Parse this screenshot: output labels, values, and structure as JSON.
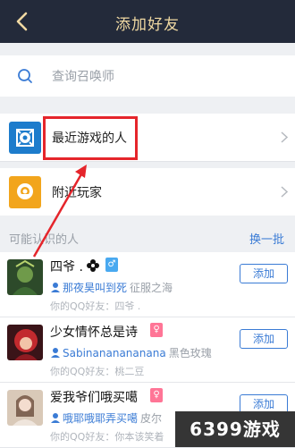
{
  "header": {
    "title": "添加好友"
  },
  "search": {
    "placeholder": "查询召唤师"
  },
  "menu": [
    {
      "label": "最近游戏的人",
      "icon": "recent-players-icon"
    },
    {
      "label": "附近玩家",
      "icon": "nearby-players-icon"
    }
  ],
  "suggest": {
    "title": "可能认识的人",
    "action": "换一批",
    "items": [
      {
        "name": "四爷 .",
        "gender": "male",
        "nickname": "那夜昊叫到死",
        "extra": "征服之海",
        "note": "你的QQ好友：四爷 .",
        "add": "添加"
      },
      {
        "name": "少女情怀总是诗",
        "gender": "female",
        "nickname": "Sabinananananana",
        "extra": "黑色玫瑰",
        "note": "你的QQ好友：桃二豆",
        "add": "添加"
      },
      {
        "name": "爱我爷们哦买噶",
        "gender": "female",
        "nickname": "哦耶哦耶弄买噶",
        "extra": "皮尔",
        "note": "你的QQ好友：你本该笑着",
        "add": "添加"
      }
    ]
  },
  "watermark": "6399游戏",
  "colors": {
    "header": "#232a3a",
    "title": "#f0d9a2",
    "accent": "#3a7bd5",
    "highlight": "#e5252b"
  }
}
